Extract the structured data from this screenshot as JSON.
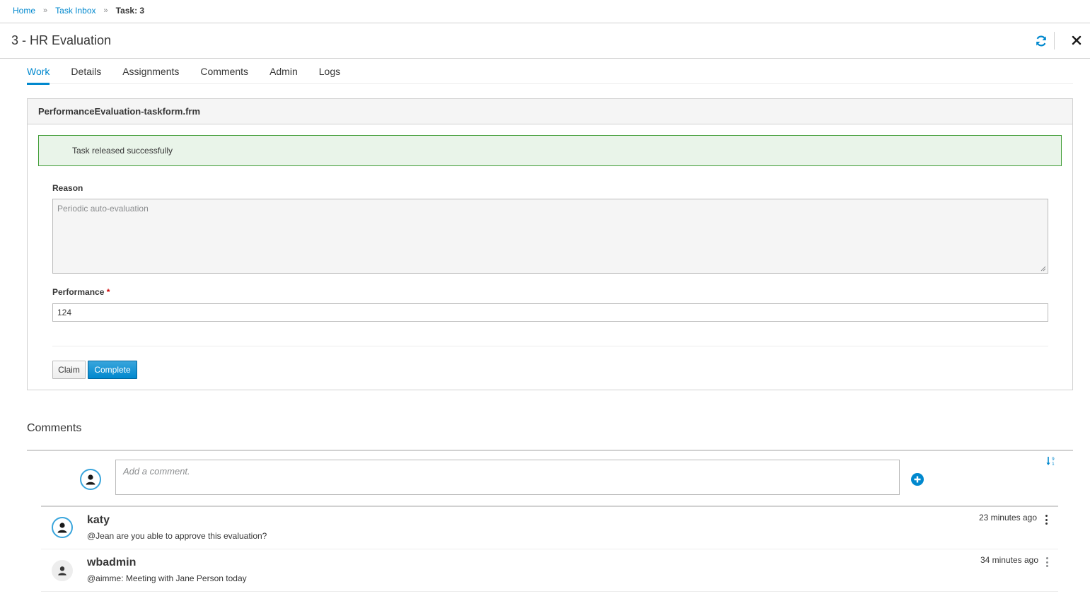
{
  "breadcrumb": {
    "home": "Home",
    "separator": "»",
    "inbox": "Task Inbox",
    "current": "Task: 3"
  },
  "header": {
    "title": "3 - HR Evaluation",
    "refresh_icon": "refresh-icon",
    "close_icon": "close-icon"
  },
  "tabs": [
    {
      "label": "Work",
      "active": true
    },
    {
      "label": "Details",
      "active": false
    },
    {
      "label": "Assignments",
      "active": false
    },
    {
      "label": "Comments",
      "active": false
    },
    {
      "label": "Admin",
      "active": false
    },
    {
      "label": "Logs",
      "active": false
    }
  ],
  "form": {
    "heading": "PerformanceEvaluation-taskform.frm",
    "alert": "Task released successfully",
    "reason_label": "Reason",
    "reason_value": "Periodic auto-evaluation",
    "performance_label": "Performance",
    "required_mark": "*",
    "performance_value": "124",
    "claim_label": "Claim",
    "complete_label": "Complete"
  },
  "comments": {
    "title": "Comments",
    "placeholder": "Add a comment.",
    "items": [
      {
        "user": "katy",
        "text": "@Jean are you able to approve this evaluation?",
        "time": "23 minutes ago"
      },
      {
        "user": "wbadmin",
        "text": "@aimme: Meeting with Jane Person today",
        "time": "34 minutes ago"
      }
    ]
  },
  "colors": {
    "accent": "#0088ce",
    "success_border": "#3f9c35",
    "success_bg": "#e9f4e9"
  }
}
